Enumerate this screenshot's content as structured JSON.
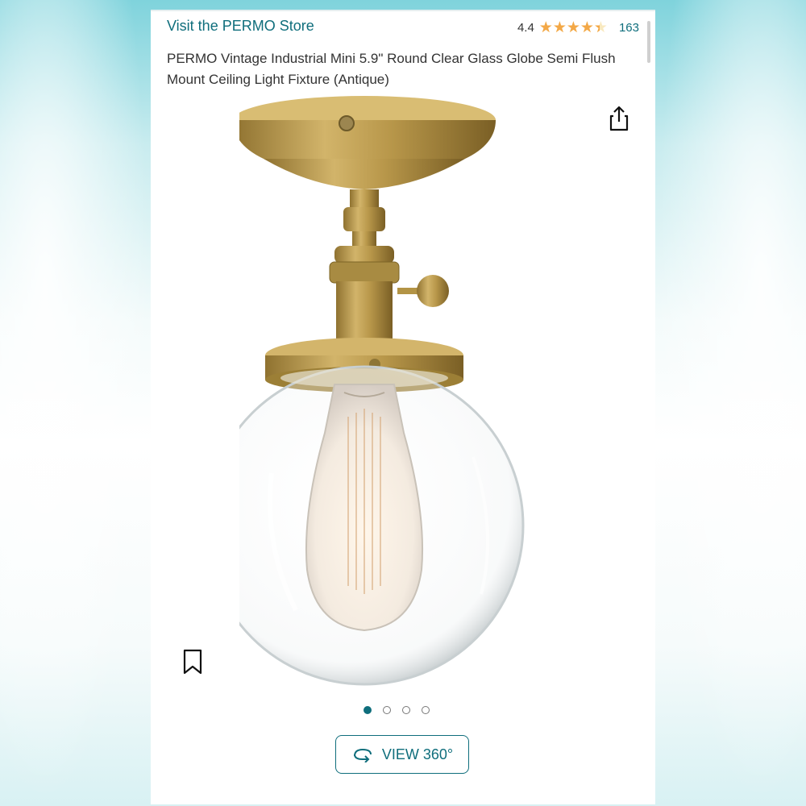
{
  "store": {
    "link_text": "Visit the PERMO Store"
  },
  "rating": {
    "value": "4.4",
    "stars": 4.4,
    "count": "163"
  },
  "product": {
    "title": "PERMO Vintage Industrial Mini 5.9\" Round Clear Glass Globe Semi Flush Mount Ceiling Light Fixture (Antique)"
  },
  "carousel": {
    "total": 4,
    "active": 1
  },
  "view360": {
    "label": "VIEW 360°"
  },
  "icons": {
    "share": "share-icon",
    "bookmark": "bookmark-icon",
    "rotate": "rotate-360-icon"
  },
  "colors": {
    "accent": "#0f6e7c",
    "star": "#f3a847",
    "brass": "#b8974a"
  }
}
